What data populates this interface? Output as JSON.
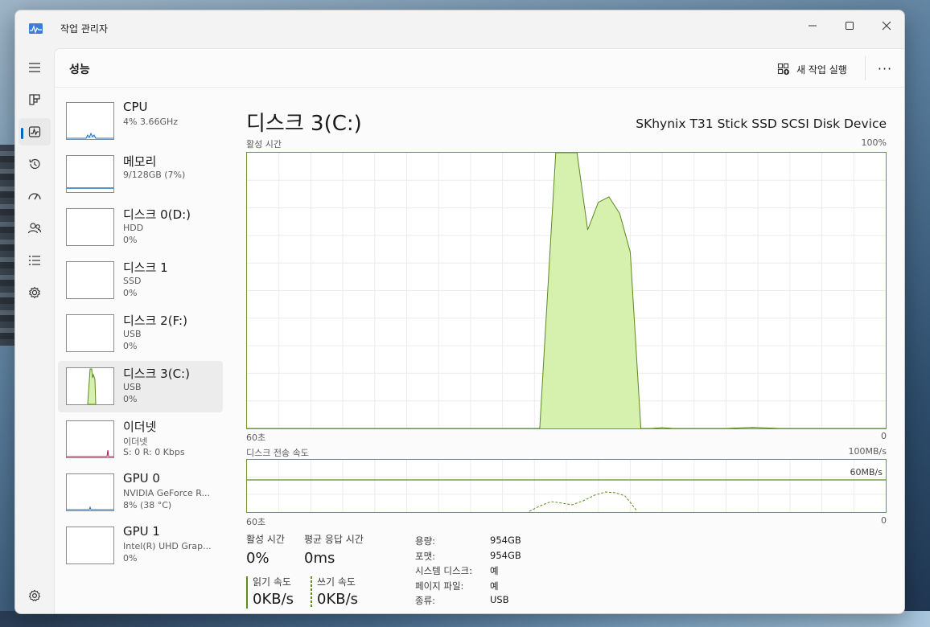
{
  "window": {
    "title": "작업 관리자"
  },
  "nav": {
    "items": [
      {
        "name": "menu-icon"
      },
      {
        "name": "processes-icon"
      },
      {
        "name": "performance-icon"
      },
      {
        "name": "app-history-icon"
      },
      {
        "name": "startup-apps-icon"
      },
      {
        "name": "users-icon"
      },
      {
        "name": "details-icon"
      },
      {
        "name": "services-icon"
      }
    ],
    "settings": {
      "name": "settings-icon"
    }
  },
  "header": {
    "title": "성능",
    "run_task_label": "새 작업 실행",
    "more_label": "···"
  },
  "devices": [
    {
      "name": "CPU",
      "sub1": "4% 3.66GHz",
      "sub2": ""
    },
    {
      "name": "메모리",
      "sub1": "9/128GB (7%)",
      "sub2": ""
    },
    {
      "name": "디스크 0(D:)",
      "sub1": "HDD",
      "sub2": "0%"
    },
    {
      "name": "디스크 1",
      "sub1": "SSD",
      "sub2": "0%"
    },
    {
      "name": "디스크 2(F:)",
      "sub1": "USB",
      "sub2": "0%"
    },
    {
      "name": "디스크 3(C:)",
      "sub1": "USB",
      "sub2": "0%"
    },
    {
      "name": "이더넷",
      "sub1": "이더넷",
      "sub2": "S: 0 R: 0 Kbps"
    },
    {
      "name": "GPU 0",
      "sub1": "NVIDIA GeForce R...",
      "sub2": "8% (38 °C)"
    },
    {
      "name": "GPU 1",
      "sub1": "Intel(R) UHD Grap...",
      "sub2": "0%"
    }
  ],
  "main": {
    "title": "디스크 3(C:)",
    "device_name": "SKhynix T31 Stick SSD SCSI Disk Device",
    "graph1": {
      "label": "활성 시간",
      "max_label": "100%",
      "x_left": "60초",
      "x_right": "0"
    },
    "graph2": {
      "label": "디스크 전송 속도",
      "max_label": "100MB/s",
      "line_label": "60MB/s",
      "x_left": "60초",
      "x_right": "0"
    }
  },
  "stats": {
    "active_label": "활성 시간",
    "active_value": "0%",
    "response_label": "평균 응답 시간",
    "response_value": "0ms",
    "read_label": "읽기 속도",
    "read_value": "0KB/s",
    "write_label": "쓰기 속도",
    "write_value": "0KB/s"
  },
  "properties": [
    {
      "key": "용량:",
      "value": "954GB"
    },
    {
      "key": "포맷:",
      "value": "954GB"
    },
    {
      "key": "시스템 디스크:",
      "value": "예"
    },
    {
      "key": "페이지 파일:",
      "value": "예"
    },
    {
      "key": "종류:",
      "value": "USB"
    }
  ],
  "chart_data": {
    "type": "area",
    "title": "활성 시간",
    "x": [
      60,
      57.5,
      55,
      52.5,
      50,
      47.5,
      45,
      42.5,
      40,
      37.5,
      35,
      33,
      32.5,
      31,
      30,
      29,
      28,
      27,
      26,
      25,
      24,
      23,
      22,
      21,
      20,
      19,
      17.5,
      15,
      12.5,
      10,
      7.5,
      5,
      2.5,
      0
    ],
    "series": [
      {
        "values": [
          0,
          0,
          0,
          0,
          0,
          0,
          0,
          0,
          0,
          0,
          0,
          0,
          0,
          100,
          100,
          100,
          72,
          82,
          84,
          78,
          64,
          0,
          0,
          0.3,
          0,
          0,
          0,
          0,
          0.4,
          0,
          0,
          0,
          0,
          0
        ]
      }
    ],
    "xlabel": "",
    "ylabel": "",
    "xlim": [
      60,
      0
    ],
    "ylim": [
      0,
      100
    ],
    "grid": true,
    "colors": {
      "line": "#5c8a1f",
      "fill": "#d6f0ad"
    }
  },
  "colors": {
    "accent": "#0067c0",
    "disk_line": "#5c8a1f",
    "disk_fill": "#d6f0ad",
    "cpu_line": "#1e73be",
    "ethernet_line": "#b8124e"
  }
}
